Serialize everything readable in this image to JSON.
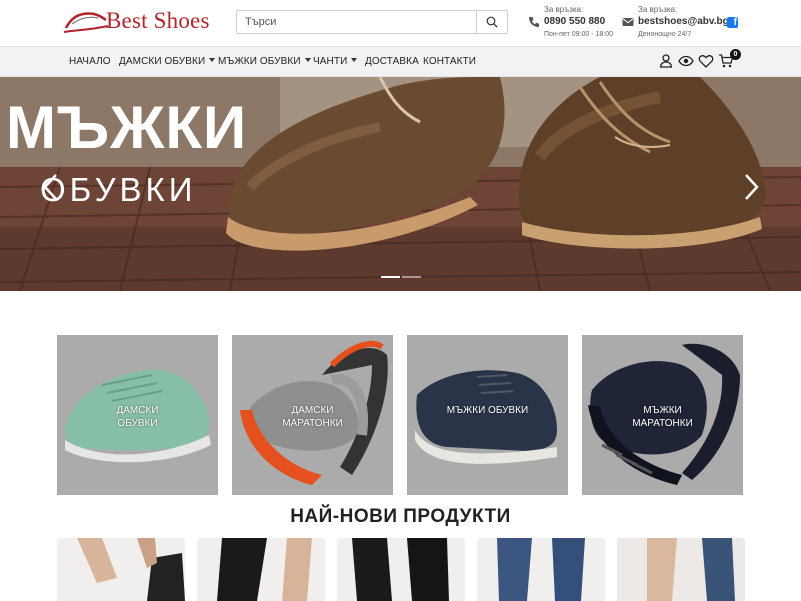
{
  "logo": {
    "text": "Best Shoes"
  },
  "search": {
    "placeholder": "Търси"
  },
  "contact_phone": {
    "label": "За връзка:",
    "value": "0890 550 880",
    "hours": "Пон-пет 09:00 - 18:00"
  },
  "contact_email": {
    "label": "За връзка:",
    "value": "bestshoes@abv.bg",
    "hours": "Денонощно 24/7"
  },
  "nav": {
    "items": [
      {
        "label": "Начало"
      },
      {
        "label": "Дамски обувки"
      },
      {
        "label": "Мъжки обувки"
      },
      {
        "label": "Чанти"
      },
      {
        "label": "Доставка"
      },
      {
        "label": "Контакти"
      }
    ],
    "cart_count": "0"
  },
  "hero": {
    "title_line1": "МЪЖКИ",
    "title_line2": "ОБУВКИ",
    "slide_count": 2,
    "active_slide": 1
  },
  "categories": [
    {
      "label_line1": "Дамски",
      "label_line2": "обувки"
    },
    {
      "label_line1": "Дамски",
      "label_line2": "маратонки"
    },
    {
      "label_line1": "Мъжки обувки",
      "label_line2": ""
    },
    {
      "label_line1": "Мъжки",
      "label_line2": "маратонки"
    }
  ],
  "section": {
    "title": "НАЙ-НОВИ ПРОДУКТИ"
  },
  "colors": {
    "brand_red": "#b0252b",
    "facebook": "#1877f2",
    "nav_bg": "#f2f2f4"
  },
  "icons": [
    "search-icon",
    "phone-icon",
    "mail-icon",
    "facebook-icon",
    "user-icon",
    "eye-icon",
    "heart-icon",
    "cart-icon",
    "chevron-left-icon",
    "chevron-right-icon"
  ]
}
